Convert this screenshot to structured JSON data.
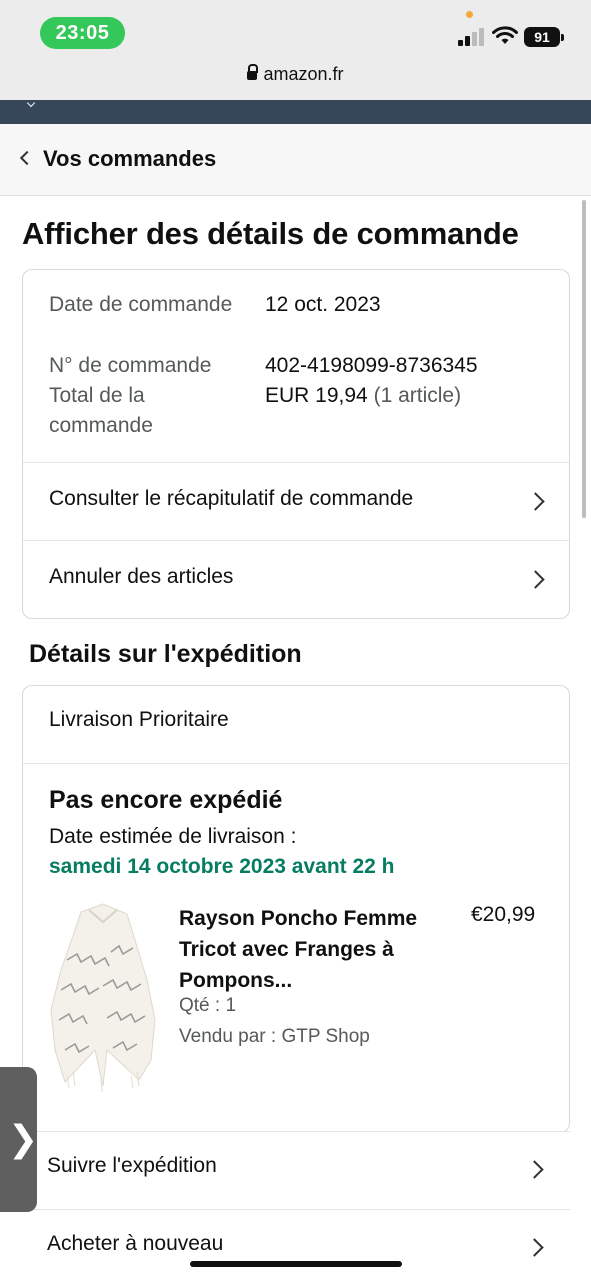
{
  "status_bar": {
    "time": "23:05",
    "battery": "91"
  },
  "browser": {
    "url": "amazon.fr"
  },
  "nav": {
    "back_label": "Vos commandes"
  },
  "page": {
    "title": "Afficher des détails de commande"
  },
  "order_summary": {
    "date_label": "Date de commande",
    "date_value": "12 oct. 2023",
    "number_label": "N° de commande",
    "number_value": "402-4198099-8736345",
    "total_label": "Total de la commande",
    "total_value": "EUR 19,94",
    "total_items": "(1 article)"
  },
  "order_links": {
    "recap": "Consulter le récapitulatif de commande",
    "cancel": "Annuler des articles"
  },
  "shipping": {
    "section_title": "Détails sur l'expédition",
    "method": "Livraison Prioritaire",
    "status": "Pas encore expédié",
    "eta_label": "Date estimée de livraison :",
    "eta_date": "samedi 14 octobre 2023 avant 22 h",
    "eta_color": "#067d62"
  },
  "product": {
    "title": "Rayson Poncho Femme Tricot avec Franges à Pompons...",
    "price": "€20,99",
    "qty": "Qté : 1",
    "seller": "Vendu par : GTP Shop",
    "image_icon": "poncho-image"
  },
  "actions": {
    "track": "Suivre l'expédition",
    "buy_again": "Acheter à nouveau"
  },
  "side_tab": {
    "glyph": "❯"
  }
}
